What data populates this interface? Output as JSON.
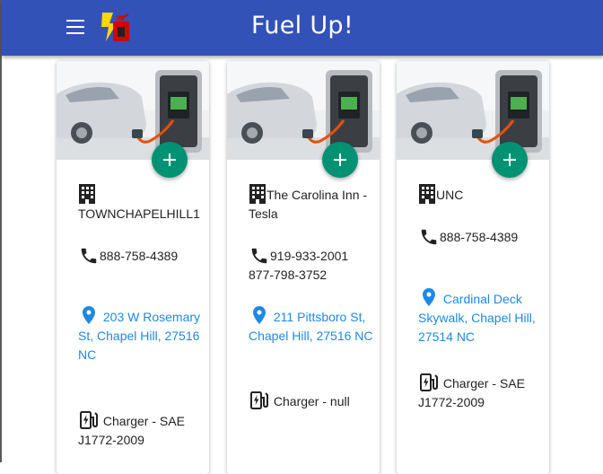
{
  "app": {
    "title": "Fuel Up!"
  },
  "icons": {
    "menu": "menu-icon",
    "logo": "fuel-can-lightning-logo",
    "add": "add-icon",
    "building": "building-icon",
    "phone": "phone-icon",
    "location": "location-pin-icon",
    "charger": "ev-charger-icon"
  },
  "colors": {
    "appbar": "#3352b8",
    "fab": "#009272",
    "link": "#1e88e5"
  },
  "stations": [
    {
      "name": "TOWNCHAPELHILL1",
      "phone": "888-758-4389",
      "address": "203 W Rosemary St, Chapel Hill, 27516 NC",
      "charger": "Charger - SAE J1772-2009"
    },
    {
      "name": "The Carolina Inn - Tesla",
      "phone": "919-933-2001 877-798-3752",
      "address": "211 Pittsboro St, Chapel Hill, 27516 NC",
      "charger": "Charger - null"
    },
    {
      "name": "UNC",
      "phone": "888-758-4389",
      "address": "Cardinal Deck Skywalk, Chapel Hill, 27514 NC",
      "charger": "Charger - SAE J1772-2009"
    }
  ]
}
